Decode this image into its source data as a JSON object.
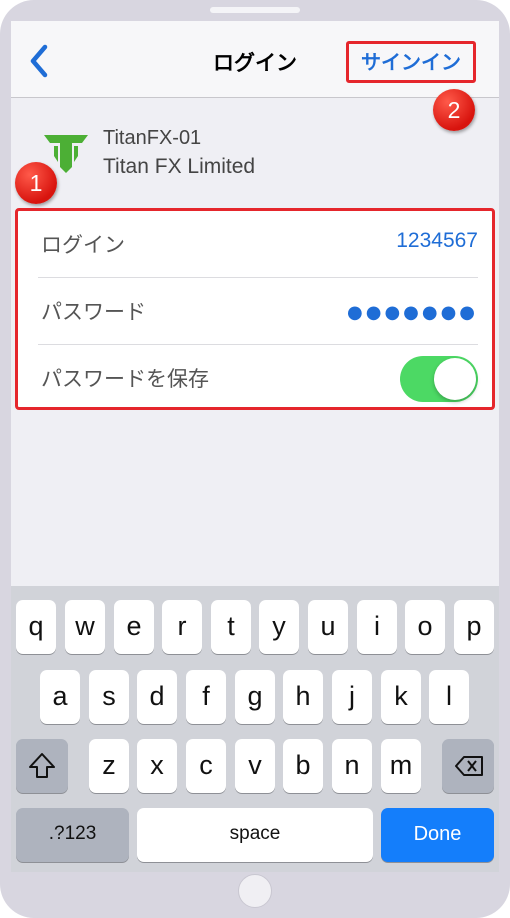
{
  "nav": {
    "title": "ログイン",
    "sign_in_label": "サインイン"
  },
  "badges": {
    "form": "1",
    "sign_in": "2"
  },
  "account": {
    "name": "TitanFX-01",
    "company": "Titan FX Limited",
    "logo_icon": "titan-shield-logo",
    "logo_color": "#4caf35"
  },
  "form": {
    "login_label": "ログイン",
    "login_value": "1234567",
    "password_label": "パスワード",
    "password_value": "●●●●●●●",
    "save_password_label": "パスワードを保存",
    "save_password_on": true
  },
  "keyboard": {
    "row1": [
      "q",
      "w",
      "e",
      "r",
      "t",
      "y",
      "u",
      "i",
      "o",
      "p"
    ],
    "row2": [
      "a",
      "s",
      "d",
      "f",
      "g",
      "h",
      "j",
      "k",
      "l"
    ],
    "row3": [
      "z",
      "x",
      "c",
      "v",
      "b",
      "n",
      "m"
    ],
    "numbers_label": ".?123",
    "space_label": "space",
    "done_label": "Done"
  },
  "colors": {
    "accent": "#1f6dd6",
    "highlight_border": "#e5262c",
    "toggle_on": "#4cd964",
    "done_key": "#147efb"
  }
}
